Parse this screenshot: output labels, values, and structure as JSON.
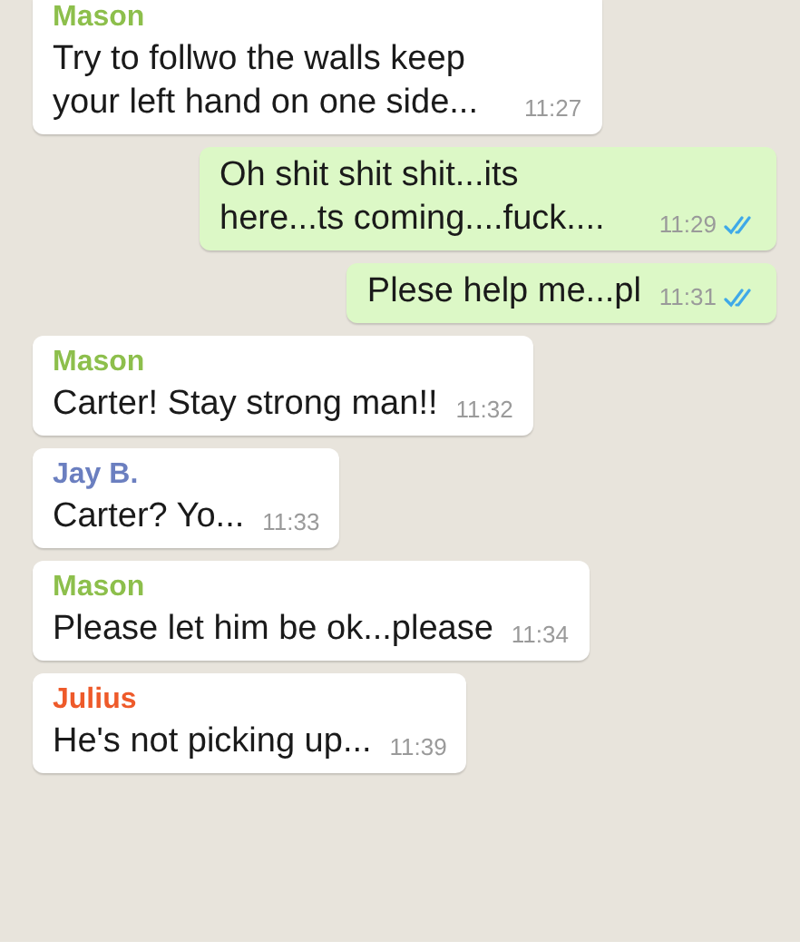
{
  "messages": [
    {
      "kind": "incoming",
      "sender": "Mason",
      "color": "#8dbf4c",
      "text": "Try to follwo the walls keep your left hand on one side...",
      "time": "11:27"
    },
    {
      "kind": "outgoing",
      "text": "Oh shit shit shit...its here...ts coming....fuck....",
      "time": "11:29",
      "read": true
    },
    {
      "kind": "outgoing",
      "text": "Plese help me...pl",
      "time": "11:31",
      "read": true
    },
    {
      "kind": "incoming",
      "sender": "Mason",
      "color": "#8dbf4c",
      "text": "Carter! Stay strong man!!",
      "time": "11:32"
    },
    {
      "kind": "incoming",
      "sender": "Jay B.",
      "color": "#6b7fc0",
      "text": "Carter? Yo...",
      "time": "11:33"
    },
    {
      "kind": "incoming",
      "sender": "Mason",
      "color": "#8dbf4c",
      "text": "Please let him be ok...please",
      "time": "11:34"
    },
    {
      "kind": "incoming",
      "sender": "Julius",
      "color": "#ee5a2a",
      "text": "He's not picking up...",
      "time": "11:39"
    }
  ]
}
